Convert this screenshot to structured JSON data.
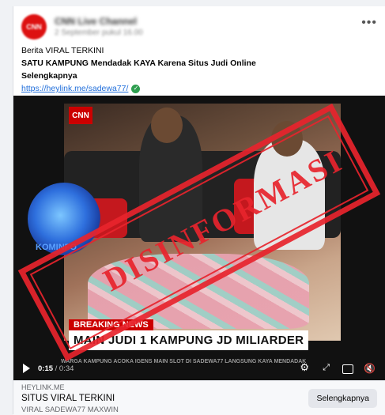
{
  "post": {
    "page_name": "CNN Live Channel",
    "time": "2 September pukul 16.00",
    "line1": "Berita VIRAL TERKINI",
    "line2": "SATU KAMPUNG Mendadak KAYA Karena Situs Judi Online",
    "line3": "Selengkapnya",
    "link": "https://heylink.me/sadewa77/"
  },
  "video": {
    "logo": "CNN",
    "breaking": "BREAKING NEWS",
    "headline": "MAIN JUDI 1 KAMPUNG JD MILIARDER",
    "ticker": "WARGA KAMPUNG ACOKA IGENS MAIN SLOT DI SADEWA77 LANGSUNG KAYA MENDADAK",
    "time_current": "0:15",
    "time_total": "/ 0:34",
    "stamp": "DISINFORMASI",
    "watermark": "KOMINFO",
    "avatar_text": "CNN"
  },
  "footer": {
    "domain": "HEYLINK.ME",
    "title": "SITUS VIRAL TERKINI",
    "subtitle": "VIRAL SADEWA77 MAXWIN",
    "cta": "Selengkapnya"
  },
  "icons": {
    "play": "play-icon",
    "settings": "gear-icon",
    "fullscreen": "expand-icon",
    "pip": "pip-icon",
    "volume": "volume-icon",
    "more": "more-icon",
    "verified": "check-icon"
  },
  "colors": {
    "stamp": "#e8242d",
    "link": "#216fdb",
    "cnn_red": "#cc0000"
  }
}
